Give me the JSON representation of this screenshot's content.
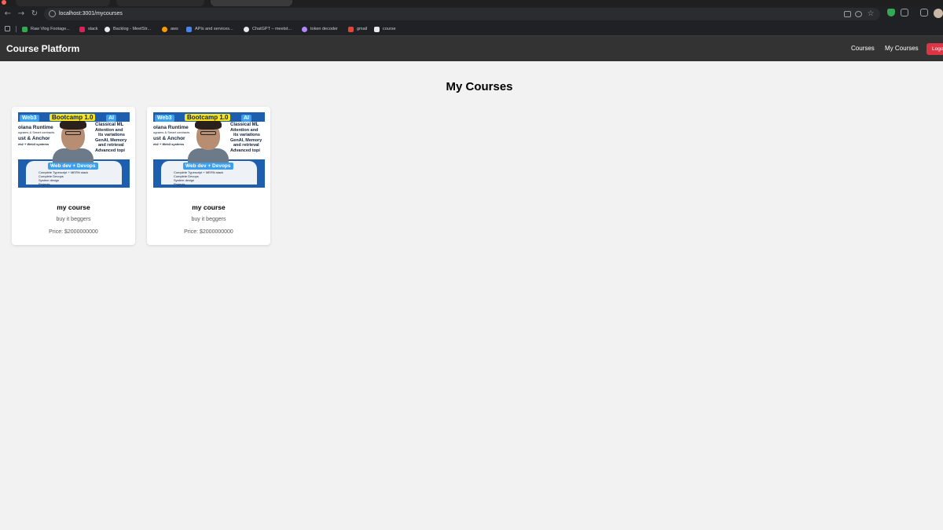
{
  "browser": {
    "url": "localhost:3001/mycourses",
    "bookmarks": [
      {
        "label": "Raw Vlog Footage...",
        "color": "#34a853"
      },
      {
        "label": "slack",
        "color": "#e01e5a"
      },
      {
        "label": "Backlog - MeetStr...",
        "color": "#e8eaed"
      },
      {
        "label": "aws",
        "color": "#ff9900"
      },
      {
        "label": "APIs and services...",
        "color": "#4285f4"
      },
      {
        "label": "ChatGPT – meetst...",
        "color": "#e8eaed"
      },
      {
        "label": "token decoder",
        "color": "#b388ff"
      },
      {
        "label": "gmail",
        "color": "#ea4335"
      },
      {
        "label": "course",
        "color": "#e8eaed"
      }
    ]
  },
  "navbar": {
    "brand": "Course Platform",
    "links": [
      "Courses",
      "My Courses"
    ],
    "logout_label": "Logout"
  },
  "main": {
    "title": "My Courses",
    "courses": [
      {
        "title": "my course",
        "description": "buy it beggers",
        "price": "Price: $2000000000",
        "thumbnail": {
          "badge": "Bootcamp 1.0",
          "tag_left": "Web3",
          "tag_right": "AI",
          "left_lines": [
            "olana Runtime",
            "ograms & Smart contracts",
            "ust & Anchor",
            "eb2 + Web3 systems"
          ],
          "right_lines": [
            "Classical ML",
            "Attention and",
            "its variations",
            "GenAI, Memory",
            "and retrieval",
            "Advanced topi"
          ],
          "bottom_tag": "Web dev + Devops",
          "bottom_lines": [
            "Complete Typescript + MERN stack",
            "Complete Devops",
            "System design",
            "Projects"
          ]
        }
      },
      {
        "title": "my course",
        "description": "buy it beggers",
        "price": "Price: $2000000000",
        "thumbnail": {
          "badge": "Bootcamp 1.0",
          "tag_left": "Web3",
          "tag_right": "AI",
          "left_lines": [
            "olana Runtime",
            "ograms & Smart contracts",
            "ust & Anchor",
            "eb2 + Web3 systems"
          ],
          "right_lines": [
            "Classical ML",
            "Attention and",
            "its variations",
            "GenAI, Memory",
            "and retrieval",
            "Advanced topi"
          ],
          "bottom_tag": "Web dev + Devops",
          "bottom_lines": [
            "Complete Typescript + MERN stack",
            "Complete Devops",
            "System design",
            "Projects"
          ]
        }
      }
    ]
  }
}
